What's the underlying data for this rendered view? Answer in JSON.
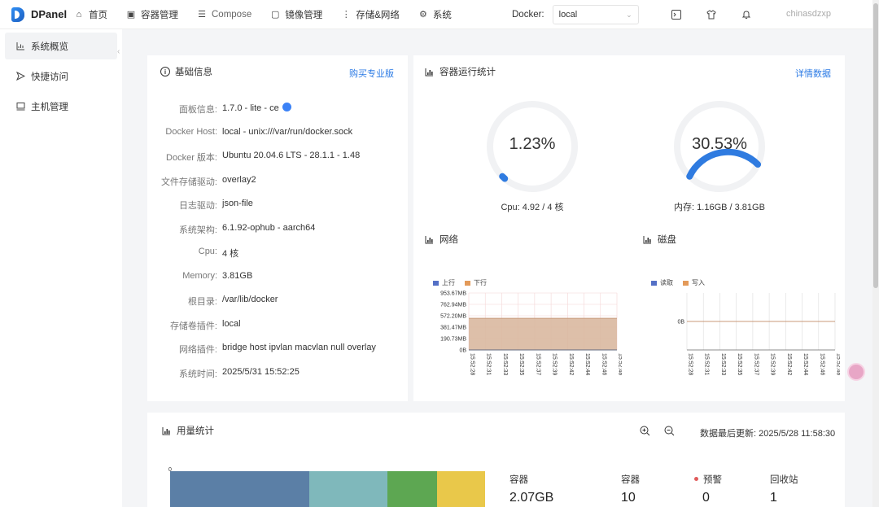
{
  "app": {
    "name": "DPanel"
  },
  "nav": [
    {
      "label": "首页",
      "icon": "home-icon"
    },
    {
      "label": "容器管理",
      "icon": "container-icon"
    },
    {
      "label": "Compose",
      "icon": "compose-icon"
    },
    {
      "label": "镜像管理",
      "icon": "image-icon"
    },
    {
      "label": "存储&网络",
      "icon": "storage-icon"
    },
    {
      "label": "系统",
      "icon": "gear-icon"
    }
  ],
  "docker": {
    "label": "Docker:",
    "selected": "local"
  },
  "user": {
    "name": "chinasdzxp"
  },
  "sidebar": {
    "items": [
      {
        "label": "系统概览",
        "icon": "chart-icon",
        "active": true
      },
      {
        "label": "快捷访问",
        "icon": "send-icon"
      },
      {
        "label": "主机管理",
        "icon": "monitor-icon"
      }
    ]
  },
  "basic": {
    "title": "基础信息",
    "action": "购买专业版",
    "rows": [
      {
        "label": "面板信息:",
        "value": "1.7.0  -  lite  -  ce"
      },
      {
        "label": "Docker Host:",
        "value": "local - unix:///var/run/docker.sock"
      },
      {
        "label": "Docker 版本:",
        "value": "Ubuntu 20.04.6 LTS - 28.1.1 - 1.48"
      },
      {
        "label": "文件存储驱动:",
        "value": "overlay2"
      },
      {
        "label": "日志驱动:",
        "value": "json-file"
      },
      {
        "label": "系统架构:",
        "value": "6.1.92-ophub - aarch64"
      },
      {
        "label": "Cpu:",
        "value": "4 核"
      },
      {
        "label": "Memory:",
        "value": "3.81GB"
      },
      {
        "label": "根目录:",
        "value": "/var/lib/docker"
      },
      {
        "label": "存储卷插件:",
        "value": "local"
      },
      {
        "label": "网络插件:",
        "value": "bridge  host  ipvlan  macvlan  null  overlay"
      },
      {
        "label": "系统时间:",
        "value": "2025/5/31 15:52:25"
      }
    ]
  },
  "stats": {
    "title": "容器运行统计",
    "action": "详情数据",
    "cpu": {
      "value": "1.23%",
      "percent": 1.23,
      "caption": "Cpu: 4.92 / 4 核"
    },
    "mem": {
      "value": "30.53%",
      "percent": 30.53,
      "caption": "内存: 1.16GB / 3.81GB"
    },
    "network_title": "网络",
    "disk_title": "磁盘"
  },
  "colors": {
    "accent": "#2c7be5",
    "series_blue": "#5470c6",
    "series_orange": "#e39a5a"
  },
  "chart_data": [
    {
      "type": "area",
      "title": "网络",
      "legend": [
        "上行",
        "下行"
      ],
      "y_ticks": [
        "953.67MB",
        "762.94MB",
        "572.20MB",
        "381.47MB",
        "190.73MB",
        "0B"
      ],
      "ylim": [
        0,
        953.67
      ],
      "x": [
        "15:52:28",
        "15:52:31",
        "15:52:33",
        "15:52:35",
        "15:52:37",
        "15:52:39",
        "15:52:42",
        "15:52:44",
        "15:52:46",
        "15:52:48"
      ],
      "series": [
        {
          "name": "上行",
          "values": [
            0,
            0,
            0,
            0,
            0,
            0,
            0,
            0,
            0,
            0
          ]
        },
        {
          "name": "下行",
          "values": [
            530,
            530,
            530,
            530,
            530,
            530,
            530,
            530,
            530,
            530
          ]
        }
      ]
    },
    {
      "type": "line",
      "title": "磁盘",
      "legend": [
        "读取",
        "写入"
      ],
      "y_ticks": [
        "0B"
      ],
      "x": [
        "15:52:28",
        "15:52:31",
        "15:52:33",
        "15:52:35",
        "15:52:37",
        "15:52:39",
        "15:52:42",
        "15:52:44",
        "15:52:46",
        "15:52:48"
      ],
      "series": [
        {
          "name": "读取",
          "values": [
            0,
            0,
            0,
            0,
            0,
            0,
            0,
            0,
            0,
            0
          ]
        },
        {
          "name": "写入",
          "values": [
            0,
            0,
            0,
            0,
            0,
            0,
            0,
            0,
            0,
            0
          ]
        }
      ]
    }
  ],
  "usage": {
    "title": "用量统计",
    "updated": "数据最后更新: 2025/5/28 11:58:30",
    "stats": [
      {
        "label": "容器",
        "value": "2.07GB"
      },
      {
        "label": "容器",
        "value": "10"
      },
      {
        "label": "预警",
        "value": "0"
      },
      {
        "label": "回收站",
        "value": "1"
      }
    ],
    "bar": [
      {
        "share": 0.441,
        "color": "#5b7fa6"
      },
      {
        "share": 0.25,
        "color": "#7fb8bb"
      },
      {
        "share": 0.156,
        "color": "#5da752"
      },
      {
        "share": 0.153,
        "color": "#e9c84a"
      }
    ]
  }
}
